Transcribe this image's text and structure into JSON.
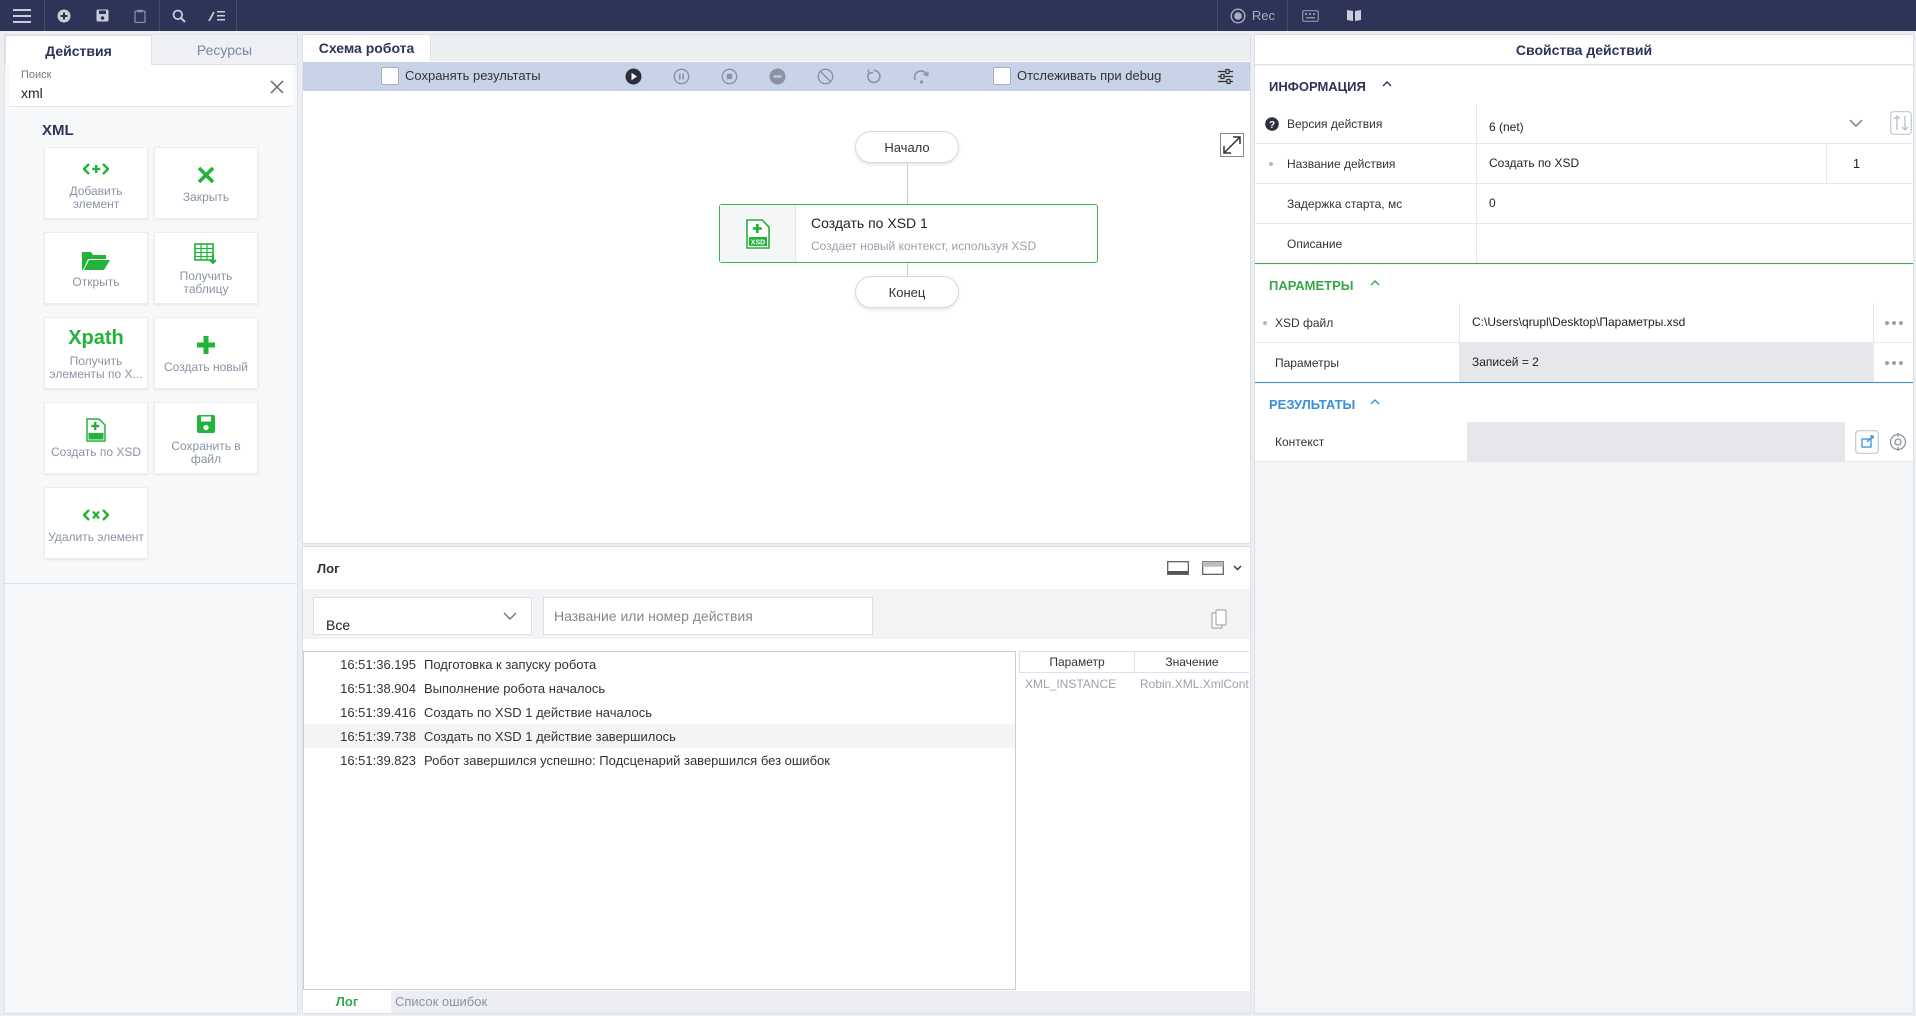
{
  "left": {
    "tabs": [
      {
        "label": "Действия"
      },
      {
        "label": "Ресурсы"
      }
    ],
    "search": {
      "label": "Поиск",
      "value": "xml"
    },
    "group_title": "XML",
    "tiles": [
      {
        "label": "Добавить элемент",
        "icon": "add-element-icon"
      },
      {
        "label": "Закрыть",
        "icon": "close-x-icon"
      },
      {
        "label": "Открыть",
        "icon": "folder-open-icon"
      },
      {
        "label": "Получить таблицу",
        "icon": "table-download-icon"
      },
      {
        "label": "Получить элементы по X...",
        "icon": "xpath-icon",
        "icon_text": "Xpath"
      },
      {
        "label": "Создать новый",
        "icon": "plus-icon"
      },
      {
        "label": "Создать по XSD",
        "icon": "xsd-file-icon"
      },
      {
        "label": "Сохранить в файл",
        "icon": "save-icon"
      },
      {
        "label": "Удалить элемент",
        "icon": "remove-element-icon"
      }
    ]
  },
  "toolbar": {
    "rec_label": "Rec"
  },
  "center": {
    "tab": "Схема робота",
    "save_results": "Сохранять результаты",
    "debug_track": "Отслеживать при debug",
    "start_label": "Начало",
    "end_label": "Конец",
    "node": {
      "title": "Создать по XSD  1",
      "desc": "Создает новый контекст, используя XSD",
      "icon_text": "XSD"
    }
  },
  "log": {
    "title": "Лог",
    "filter_value": "Все",
    "search_placeholder": "Название или номер действия",
    "rows": [
      {
        "time": "16:51:36.195",
        "text": "Подготовка к запуску робота"
      },
      {
        "time": "16:51:38.904",
        "text": "Выполнение робота началось"
      },
      {
        "time": "16:51:39.416",
        "text": "Создать по XSD 1 действие началось"
      },
      {
        "time": "16:51:39.738",
        "text": "Создать по XSD 1 действие завершилось"
      },
      {
        "time": "16:51:39.823",
        "text": "Робот завершился успешно: Подсценарий завершился без ошибок"
      }
    ],
    "param_table": {
      "headers": [
        "Параметр",
        "Значение"
      ],
      "rows": [
        {
          "param": "XML_INSTANCE",
          "value": "Robin.XML.XmlContext"
        }
      ]
    },
    "tabs": [
      {
        "label": "Лог"
      },
      {
        "label": "Список ошибок"
      }
    ]
  },
  "right": {
    "title": "Свойства действий",
    "info": {
      "title": "ИНФОРМАЦИЯ",
      "version_label": "Версия действия",
      "version_value": "6 (net)",
      "name_label": "Название действия",
      "name_value": "Создать по XSD",
      "name_num": "1",
      "delay_label": "Задержка старта, мс",
      "delay_value": "0",
      "desc_label": "Описание",
      "desc_value": ""
    },
    "params": {
      "title": "ПАРАМЕТРЫ",
      "xsd_label": "XSD файл",
      "xsd_value": "C:\\Users\\qrupl\\Desktop\\Параметры.xsd",
      "params_label": "Параметры",
      "params_value": "Записей = 2"
    },
    "results": {
      "title": "РЕЗУЛЬТАТЫ",
      "context_label": "Контекст",
      "context_value": ""
    }
  },
  "colors": {
    "navy": "#2e3358",
    "green": "#22b33a",
    "section_green": "#37a84a",
    "section_blue": "#3a8fd8"
  }
}
